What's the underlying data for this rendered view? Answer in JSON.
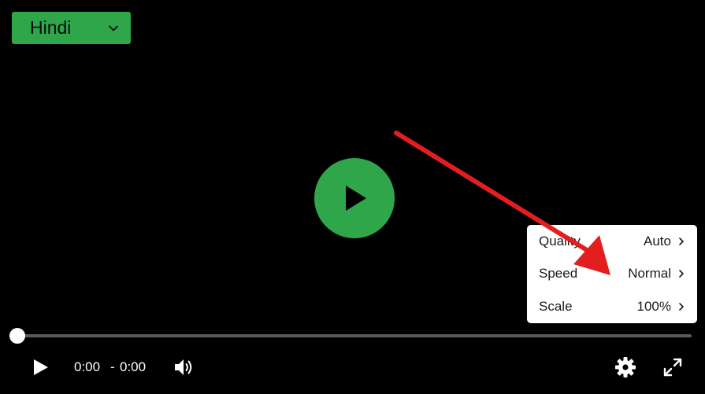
{
  "language_selector": {
    "selected": "Hindi",
    "icon": "chevron-down-icon",
    "background": "#30a64a"
  },
  "big_play": {
    "icon": "play-icon",
    "background": "#30a64a"
  },
  "settings_menu": {
    "items": [
      {
        "label": "Quality",
        "value": "Auto"
      },
      {
        "label": "Speed",
        "value": "Normal"
      },
      {
        "label": "Scale",
        "value": "100%"
      }
    ]
  },
  "annotation": {
    "shape": "arrow",
    "color": "#e31e1e",
    "points_to": "Speed"
  },
  "controls": {
    "progress": 0,
    "current_time": "0:00",
    "separator": "-",
    "duration": "0:00",
    "icons": [
      "play-icon",
      "volume-icon",
      "gear-icon",
      "fullscreen-icon"
    ]
  }
}
